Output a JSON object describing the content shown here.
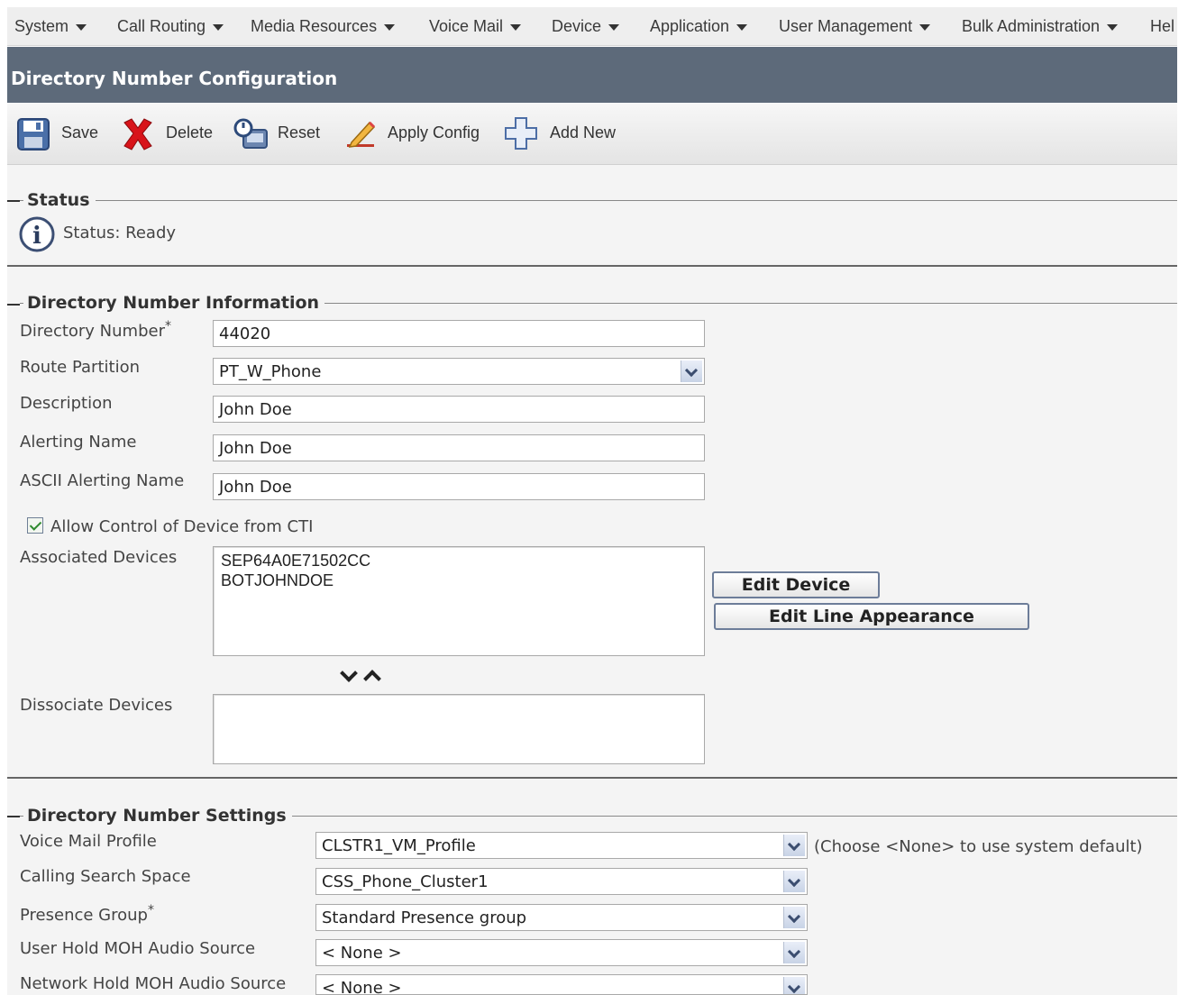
{
  "menu": {
    "items": [
      "System",
      "Call Routing",
      "Media Resources",
      "Voice Mail",
      "Device",
      "Application",
      "User Management",
      "Bulk Administration",
      "Hel"
    ]
  },
  "page": {
    "title": "Directory Number Configuration"
  },
  "toolbar": {
    "save_label": "Save",
    "delete_label": "Delete",
    "reset_label": "Reset",
    "apply_config_label": "Apply Config",
    "add_new_label": "Add New"
  },
  "status": {
    "section_title": "Status",
    "text": "Status: Ready"
  },
  "dn_info": {
    "section_title": "Directory Number Information",
    "directory_number": {
      "label": "Directory Number",
      "required_mark": "*",
      "value": "44020"
    },
    "route_partition": {
      "label": "Route Partition",
      "value": "PT_W_Phone"
    },
    "description": {
      "label": "Description",
      "value": "John Doe"
    },
    "alerting_name": {
      "label": "Alerting Name",
      "value": "John Doe"
    },
    "ascii_alerting_name": {
      "label": "ASCII Alerting Name",
      "value": "John Doe"
    },
    "allow_cti": {
      "label": "Allow Control of Device from CTI",
      "checked": true
    },
    "associated_devices": {
      "label": "Associated Devices",
      "items": [
        "SEP64A0E71502CC",
        "BOTJOHNDOE"
      ]
    },
    "edit_device_label": "Edit Device",
    "edit_line_appearance_label": "Edit Line Appearance",
    "dissociate_devices": {
      "label": "Dissociate Devices",
      "items": []
    }
  },
  "dn_settings": {
    "section_title": "Directory Number Settings",
    "voice_mail_profile": {
      "label": "Voice Mail Profile",
      "value": "CLSTR1_VM_Profile",
      "hint": "(Choose <None> to use system default)"
    },
    "calling_search_space": {
      "label": "Calling Search Space",
      "value": "CSS_Phone_Cluster1"
    },
    "presence_group": {
      "label": "Presence Group",
      "required_mark": "*",
      "value": "Standard Presence group"
    },
    "user_hold_moh": {
      "label": "User Hold MOH Audio Source",
      "value": "< None >"
    },
    "network_hold_moh": {
      "label": "Network Hold MOH Audio Source",
      "value": "< None >"
    }
  },
  "colors": {
    "title_bar": "#5d6a7a",
    "menu_bg": "#eeeeee",
    "content_bg": "#f4f4f4",
    "button_border": "#6d7d99"
  }
}
